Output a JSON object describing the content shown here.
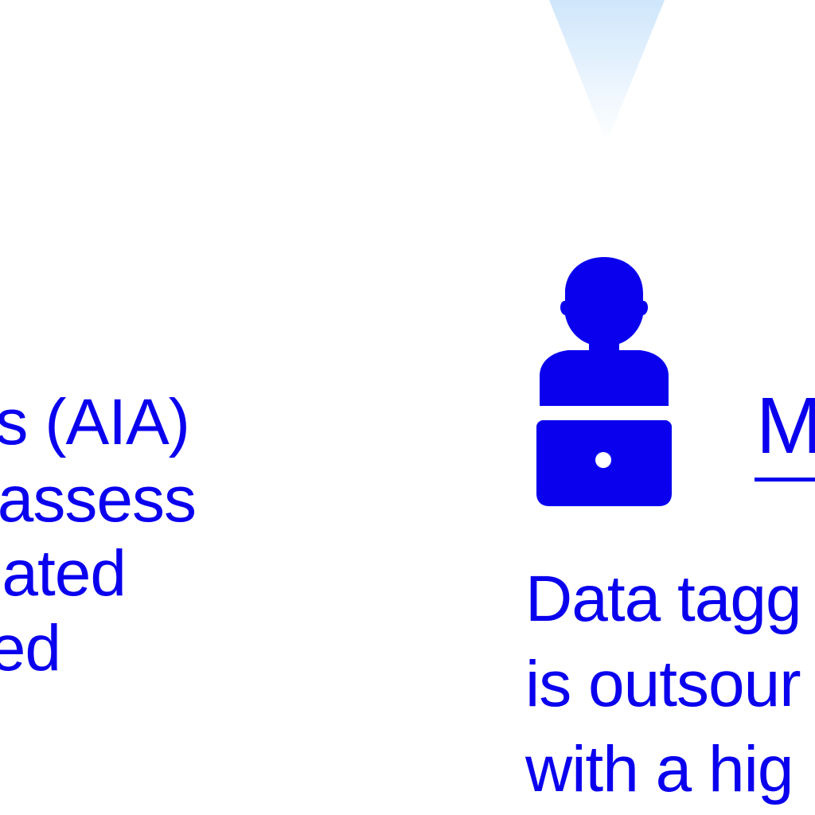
{
  "colors": {
    "accent": "#0a00ee",
    "background": "#ffffff",
    "funnel_top": "#cfe6fb",
    "funnel_bottom": "#ffffff"
  },
  "icons": {
    "funnel": "funnel-shape-icon",
    "person": "person-at-laptop-icon"
  },
  "left_column": {
    "lines": [
      "s (AIA)",
      "assess",
      "ated",
      "ed"
    ]
  },
  "right_column": {
    "heading": "M",
    "lines": [
      "Data tagg",
      "is outsour",
      "with a hig"
    ]
  }
}
